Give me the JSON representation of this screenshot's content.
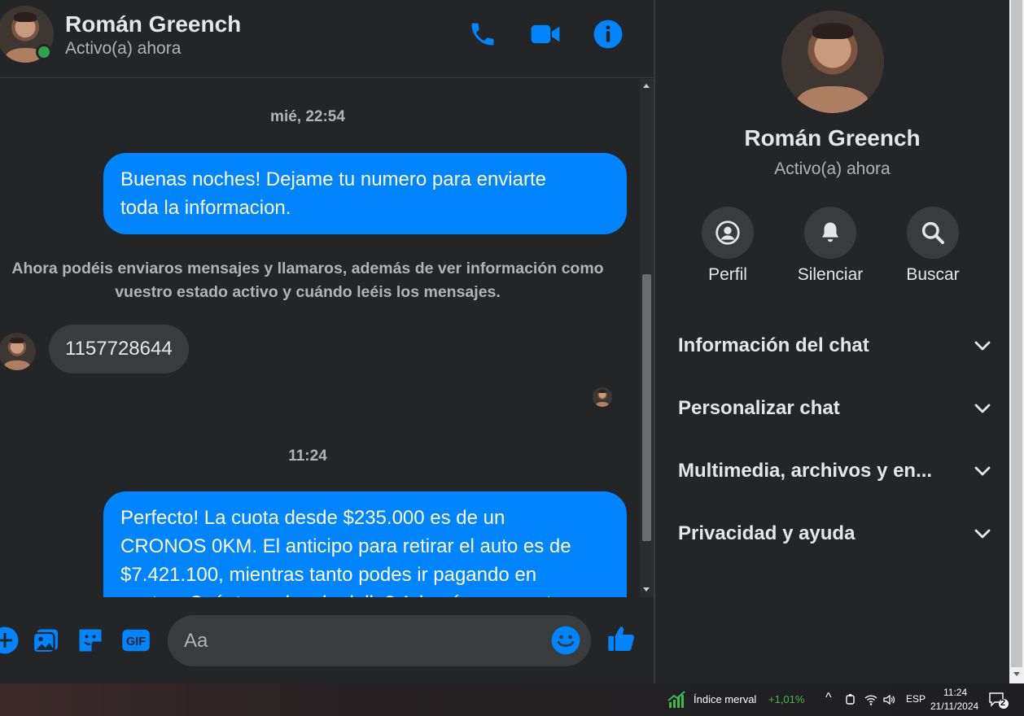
{
  "header": {
    "name": "Román Greench",
    "status": "Activo(a) ahora"
  },
  "messages": {
    "ts1": "mié, 22:54",
    "out1_line1": "Buenas noches! Dejame tu numero para enviarte",
    "out1_line2": "toda la informacion.",
    "system_line1": "Ahora podéis enviaros mensajes y llamaros, además de ver información como",
    "system_line2": "vuestro estado activo y cuándo leéis los mensajes.",
    "in1": "1157728644",
    "ts2": "11:24",
    "out2_line1": "Perfecto! La cuota desde $235.000 es de un",
    "out2_line2": "CRONOS 0KM. El anticipo para retirar el auto es de",
    "out2_line3": "$7.421.100, mientras tanto podes ir pagando en",
    "out2_line4": "cuotas. Cuánto podes de dolla? Además en cuanto"
  },
  "composer": {
    "placeholder": "Aa"
  },
  "panel": {
    "name": "Román Greench",
    "status": "Activo(a) ahora",
    "actions": [
      {
        "label": "Perfil",
        "icon": "profile-icon"
      },
      {
        "label": "Silenciar",
        "icon": "bell-icon"
      },
      {
        "label": "Buscar",
        "icon": "search-icon"
      }
    ],
    "sections": [
      "Información del chat",
      "Personalizar chat",
      "Multimedia, archivos y en...",
      "Privacidad y ayuda"
    ]
  },
  "taskbar": {
    "widget_label": "Índice merval",
    "widget_value": "+1,01%",
    "language": "ESP",
    "time": "11:24",
    "date": "21/11/2024",
    "notifications": "2"
  },
  "colors": {
    "accent": "#0084ff",
    "background": "#242526",
    "bubble_in": "#3a3b3c",
    "online": "#31a24c"
  }
}
